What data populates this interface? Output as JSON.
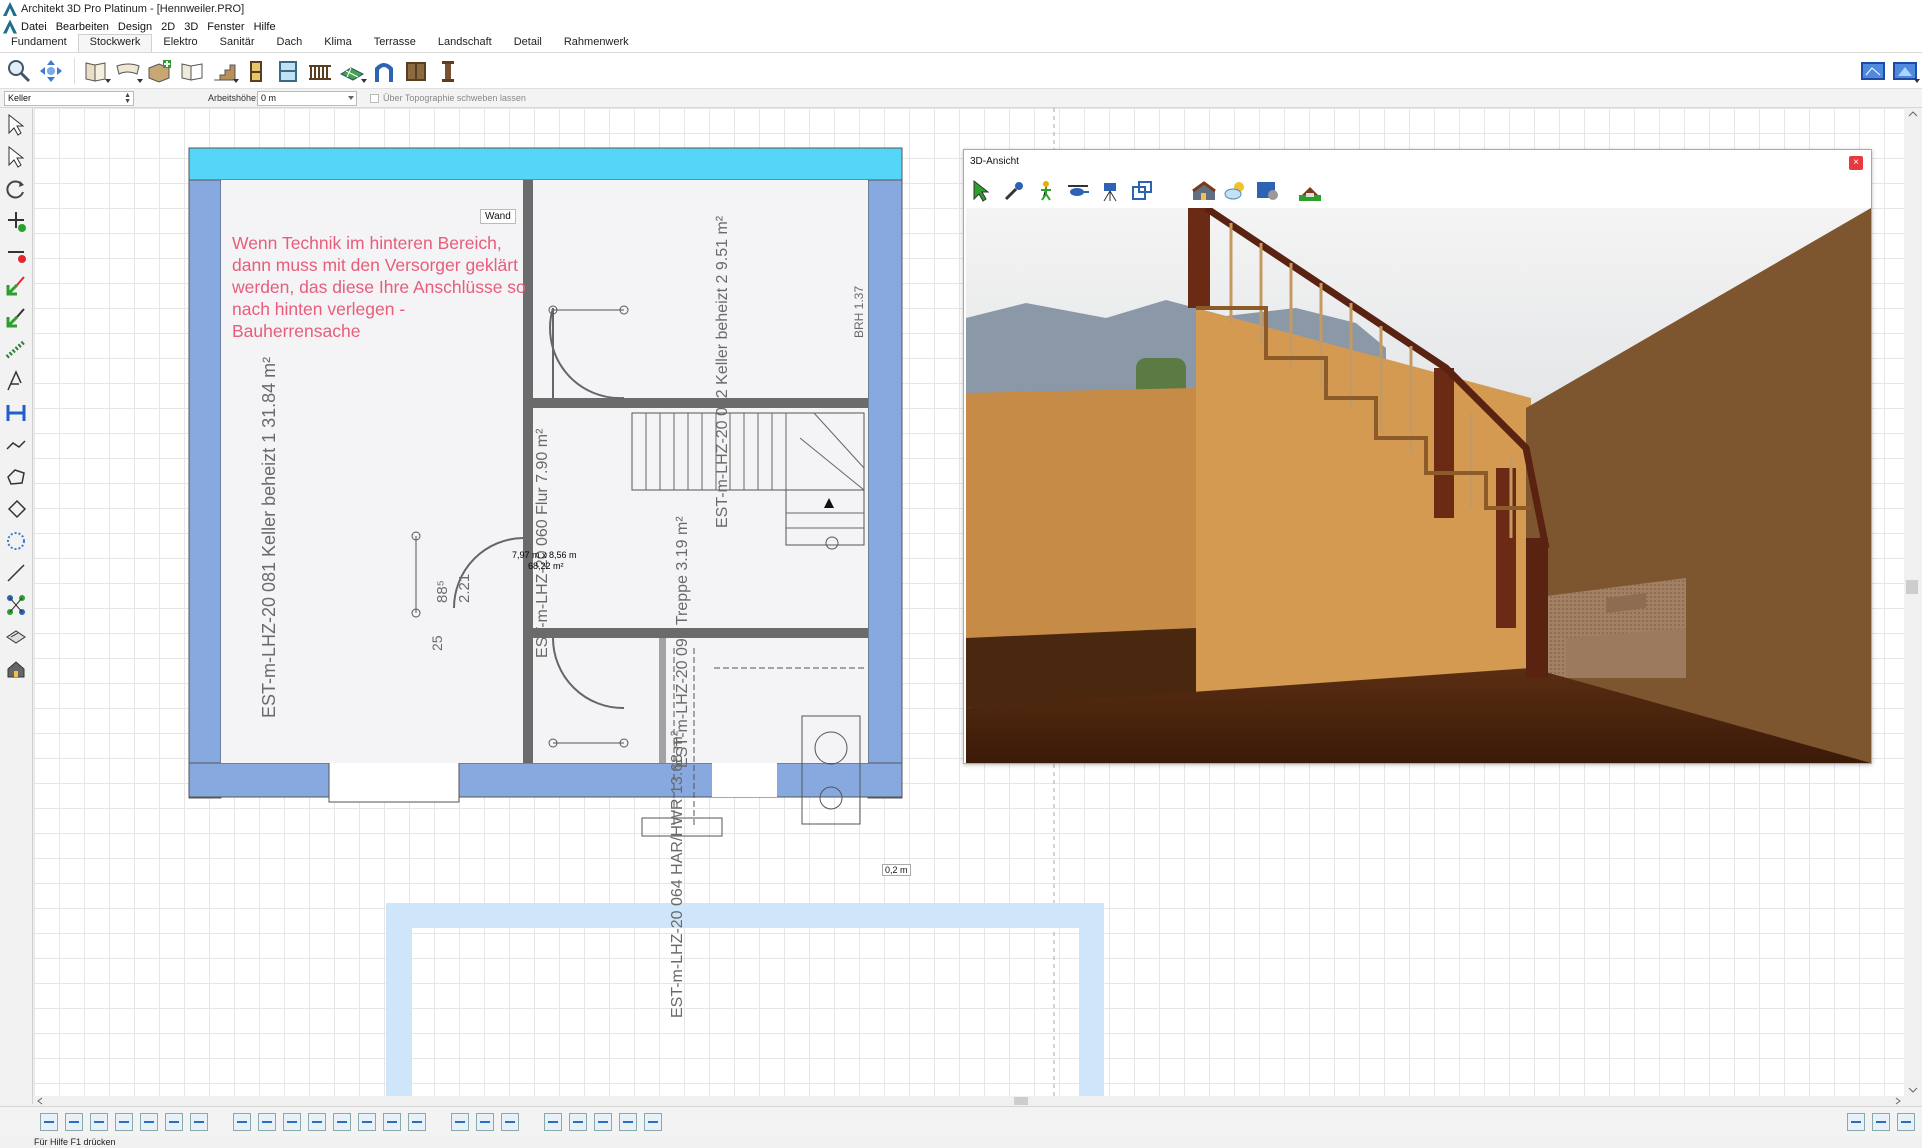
{
  "window": {
    "title": "Architekt 3D Pro Platinum - [Hennweiler.PRO]"
  },
  "menu": {
    "items": [
      "Datei",
      "Bearbeiten",
      "Design",
      "2D",
      "3D",
      "Fenster",
      "Hilfe"
    ]
  },
  "ribbon_tabs": {
    "items": [
      "Fundament",
      "Stockwerk",
      "Elektro",
      "Sanitär",
      "Dach",
      "Klima",
      "Terrasse",
      "Landschaft",
      "Detail",
      "Rahmenwerk"
    ],
    "active": "Stockwerk"
  },
  "properties": {
    "floor_select": "Keller",
    "height_label": "Arbeitshöhe:",
    "height_value": "0 m",
    "topo_checkbox_label": "Über Topographie schweben lassen"
  },
  "view3d": {
    "title": "3D-Ansicht",
    "close_label": "×"
  },
  "plan": {
    "annotation": "Wenn Technik im hinteren Bereich, dann muss mit den Versorger geklärt werden, das diese Ihre Anschlüsse so nach hinten verlegen - Bauherrensache",
    "wall_label": "Wand",
    "room_dims_line1": "7,97 m x 8,56 m",
    "room_dims_line2": "68,22 m²",
    "measure": "0,2 m",
    "scan_texts": {
      "room1": "EST-m-LHZ-20   081   Keller beheizt 1   31.84 m²",
      "room2": "EST-m-LHZ-20   082   Keller beheizt 2   9.51 m²",
      "flur": "EST-m-LHZ-20   060   Flur   7.90 m²",
      "treppe": "EST-m-LHZ-20   099   Treppe   3.19 m²",
      "har": "EST-m-LHZ-20   064   HAR/HWR   13.68 m²",
      "brh": "BRH 1.37",
      "door_w": "88⁵",
      "door_h": "2.21",
      "dim_25": "25"
    }
  },
  "status": {
    "text": "Für Hilfe F1 drücken"
  },
  "colors": {
    "wall_blue": "#88a9df",
    "wall_cyan": "#54d6f8",
    "annotation_pink": "#e85d7a"
  }
}
